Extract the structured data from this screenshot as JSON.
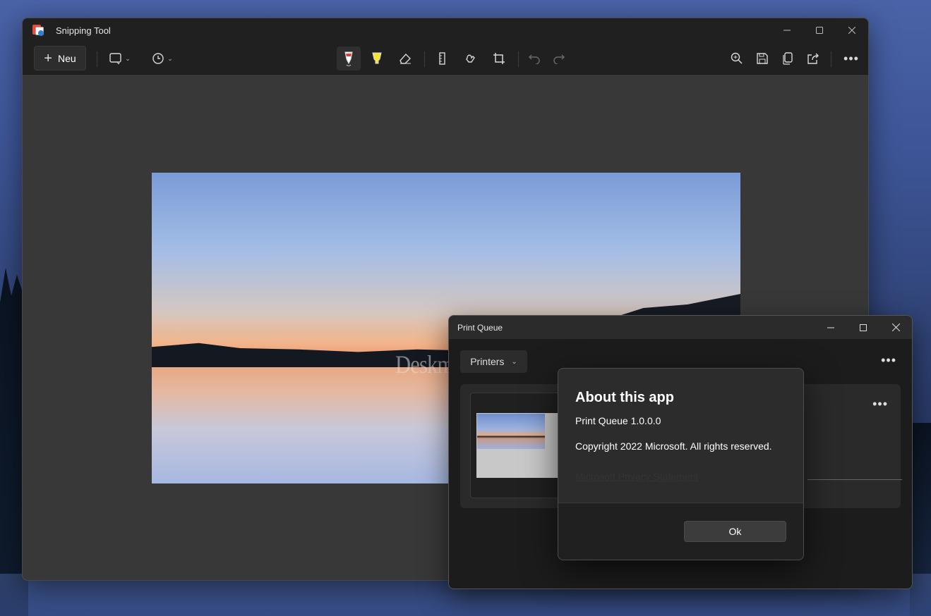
{
  "snipping_tool": {
    "title": "Snipping Tool",
    "new_button_label": "Neu",
    "toolbar_icons": [
      "snip-mode-icon",
      "delay-timer-icon",
      "ballpoint-pen-icon",
      "highlighter-icon",
      "eraser-icon",
      "ruler-icon",
      "touch-writing-icon",
      "crop-icon",
      "undo-icon",
      "redo-icon",
      "zoom-icon",
      "save-icon",
      "copy-icon",
      "share-icon",
      "more-icon"
    ],
    "active_tool": "ballpoint-pen-icon",
    "watermark": "Deskmodder.de"
  },
  "print_queue": {
    "title": "Print Queue",
    "printers_label": "Printers"
  },
  "about_dialog": {
    "title": "About this app",
    "version": "Print Queue 1.0.0.0",
    "copyright": "Copyright 2022 Microsoft. All rights reserved.",
    "privacy_link": "Microsoft Privacy Statement",
    "ok_label": "Ok"
  },
  "colors": {
    "window_bg": "#202020",
    "canvas_bg": "#383838",
    "highlighter_yellow": "#f5e43a",
    "pen_red": "#e23b3b"
  }
}
